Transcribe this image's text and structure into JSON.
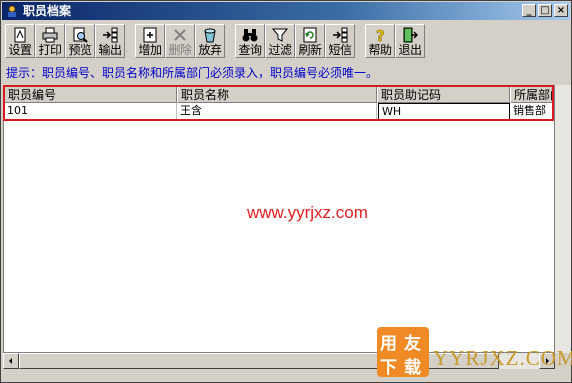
{
  "window": {
    "title": "职员档案"
  },
  "titlebar_buttons": {
    "minimize": "_",
    "maximize": "□",
    "close": "×"
  },
  "toolbar": [
    {
      "id": "settings",
      "label": "设置",
      "icon": "settings-icon",
      "enabled": true
    },
    {
      "id": "print",
      "label": "打印",
      "icon": "printer-icon",
      "enabled": true
    },
    {
      "id": "preview",
      "label": "预览",
      "icon": "preview-icon",
      "enabled": true
    },
    {
      "id": "export",
      "label": "输出",
      "icon": "export-icon",
      "enabled": true
    },
    {
      "id": "add",
      "label": "增加",
      "icon": "add-icon",
      "enabled": true
    },
    {
      "id": "delete",
      "label": "删除",
      "icon": "delete-icon",
      "enabled": false
    },
    {
      "id": "discard",
      "label": "放弃",
      "icon": "discard-icon",
      "enabled": true
    },
    {
      "id": "query",
      "label": "查询",
      "icon": "binoculars-icon",
      "enabled": true
    },
    {
      "id": "filter",
      "label": "过滤",
      "icon": "filter-icon",
      "enabled": true
    },
    {
      "id": "refresh",
      "label": "刷新",
      "icon": "refresh-icon",
      "enabled": true
    },
    {
      "id": "sms",
      "label": "短信",
      "icon": "sms-icon",
      "enabled": true
    },
    {
      "id": "help",
      "label": "帮助",
      "icon": "help-icon",
      "enabled": true
    },
    {
      "id": "exit",
      "label": "退出",
      "icon": "exit-icon",
      "enabled": true
    }
  ],
  "hint": "提示：职员编号、职员名称和所属部门必须录入，职员编号必须唯一。",
  "table": {
    "columns": [
      "职员编号",
      "职员名称",
      "职员助记码",
      "所属部门"
    ],
    "rows": [
      [
        "101",
        "王含",
        "WH",
        "销售部"
      ]
    ]
  },
  "watermark": {
    "url": "www.yyrjxz.com",
    "logo_chars": [
      "用",
      "友",
      "下",
      "载"
    ],
    "logo_text": "YYRJXZ.COM"
  },
  "colors": {
    "title_gradient_start": "#0a246a",
    "hint_text": "#0000cc",
    "highlight_border": "#d71920",
    "watermark_red": "#e02020",
    "logo_orange": "#f08a24",
    "logo_text_gold": "#c89a2a"
  }
}
